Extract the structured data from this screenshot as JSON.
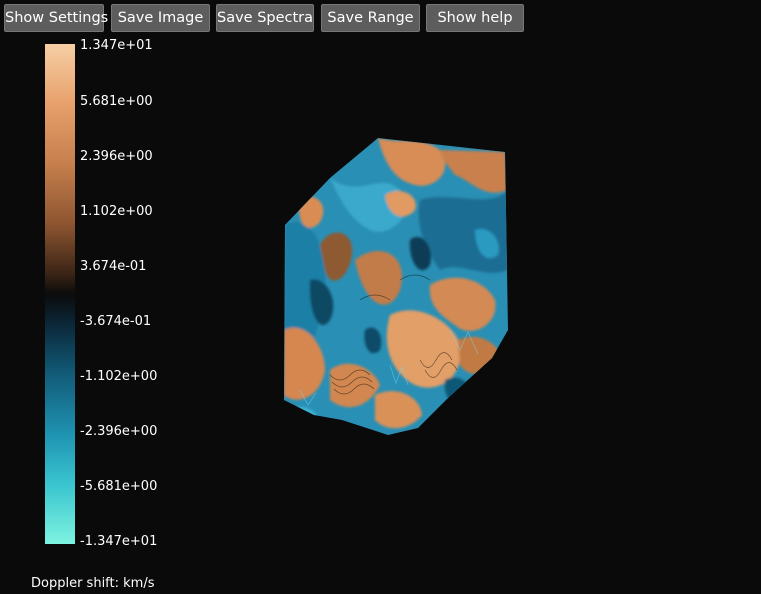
{
  "toolbar": {
    "buttons": [
      {
        "label": "Show Settings"
      },
      {
        "label": "Save Image"
      },
      {
        "label": "Save Spectra"
      },
      {
        "label": "Save Range"
      },
      {
        "label": "Show help"
      }
    ]
  },
  "colorbar": {
    "ticks": [
      "1.347e+01",
      "5.681e+00",
      "2.396e+00",
      "1.102e+00",
      "3.674e-01",
      "-3.674e-01",
      "-1.102e+00",
      "-2.396e+00",
      "-5.681e+00",
      "-1.347e+01"
    ],
    "title": "Doppler shift: km/s",
    "colors": {
      "max": "#f6cfa4",
      "positive": "#c67f4d",
      "zero": "#0b0b0b",
      "negative": "#1f92b1",
      "min": "#7ef3e0"
    }
  },
  "visualization": {
    "background": "#0a0a0a",
    "positive_color": "#d88c56",
    "negative_color": "#2390b4"
  }
}
